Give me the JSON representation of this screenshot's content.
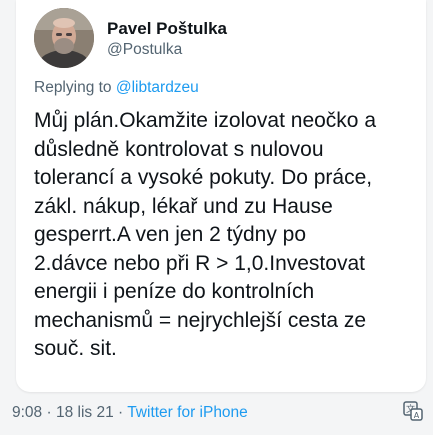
{
  "author": {
    "display_name": "Pavel Poštulka",
    "handle": "@Postulka"
  },
  "reply": {
    "prefix": "Replying to ",
    "mention": "@libtardzeu"
  },
  "tweet": {
    "lines": [
      "Můj plán.Okamžite izolovat neočko a",
      "důsledně kontrolovat s nulovou",
      "tolerancí a vysoké pokuty. Do práce,",
      "zákl. nákup, lékař und zu Hause",
      "gesperrt.A ven jen 2 týdny po",
      "2.dávce nebo při R > 1,0.Investovat",
      "energii i peníze do kontrolních",
      "mechanismů = nejrychlejší cesta ze",
      "souč. sit."
    ]
  },
  "meta": {
    "time": "9:08",
    "separator": " · ",
    "date": "18 lis 21",
    "source": "Twitter for iPhone"
  },
  "colors": {
    "text": "#0f1419",
    "secondary": "#536471",
    "accent": "#1d9bf0"
  },
  "icons": {
    "translate": "translate-icon"
  }
}
